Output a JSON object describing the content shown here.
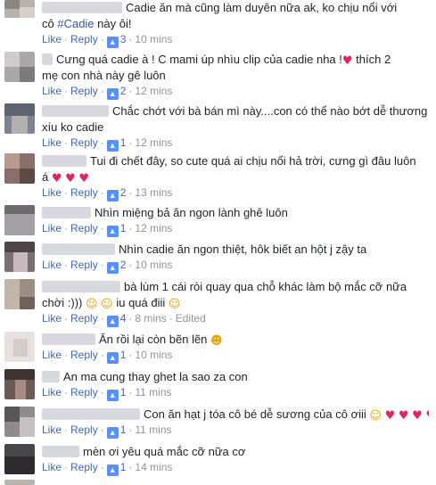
{
  "comments": [
    {
      "line1": "Cadie ăn mà cũng làm duyên nữa ak, ko chịu nổi với",
      "line2_pre": "cô ",
      "line2_tag": "#Cadie",
      "line2_post": " này ôi!",
      "like": "Like",
      "reply": "Reply",
      "likes": "3",
      "time": "10 mins"
    },
    {
      "line1": "Cưng quá cadie à ! C mami úp nhìu clip của cadie nha !",
      "line1_tail": " thích 2",
      "line2": "mẹ con nhà này gê luôn",
      "like": "Like",
      "reply": "Reply",
      "likes": "2",
      "time": "12 mins"
    },
    {
      "line1": "Chắc chớt với bà bán mì này....con có thể nào bớt dễ thương",
      "line2": "xíu ko cadie",
      "like": "Like",
      "reply": "Reply",
      "likes": "1",
      "time": "12 mins"
    },
    {
      "line1": "Tui đi chết đây, so cute quá ai chịu nổi hả trời, cưng gì đâu luôn",
      "line2": "á",
      "like": "Like",
      "reply": "Reply",
      "likes": "2",
      "time": "13 mins"
    },
    {
      "line1": "Nhìn miệng bả ăn ngon lành ghê luôn",
      "like": "Like",
      "reply": "Reply",
      "likes": "1",
      "time": "12 mins"
    },
    {
      "line1": "Nhìn cadie ăn ngon thiệt, hôk biết an hột j zậy ta",
      "like": "Like",
      "reply": "Reply",
      "likes": "2",
      "time": "10 mins"
    },
    {
      "line1": "bà lùm 1 cái ròi quay qua chỗ khác làm bộ mắc cỡ nữa",
      "line2": "chời :)))",
      "line2_mid": " iu quá điii",
      "like": "Like",
      "reply": "Reply",
      "likes": "4",
      "time": "8 mins",
      "edited": "Edited"
    },
    {
      "line1": "Ăn rồi lại còn bẽn lẽn",
      "like": "Like",
      "reply": "Reply",
      "likes": "1",
      "time": "10 mins"
    },
    {
      "line1": "An ma cung thay ghet la sao za con",
      "like": "Like",
      "reply": "Reply",
      "likes": "1",
      "time": "11 mins"
    },
    {
      "line1": "Con ăn hạt j tóa cô bé dễ sương của cô ơiii",
      "like": "Like",
      "reply": "Reply",
      "likes": "1",
      "time": "11 mins"
    },
    {
      "line1": "mèn ơi yêu quá mắc cỡ nữa cơ",
      "like": "Like",
      "reply": "Reply",
      "likes": "1",
      "time": "14 mins"
    }
  ],
  "icons": {
    "heart": "♥",
    "smiley": "☺",
    "heart_eyes": "☻",
    "thumb": "👍"
  },
  "colors": {
    "link": "#4267b2",
    "hashtag": "#365899",
    "like_badge": "#5890ff",
    "heart": "#e0245e"
  }
}
